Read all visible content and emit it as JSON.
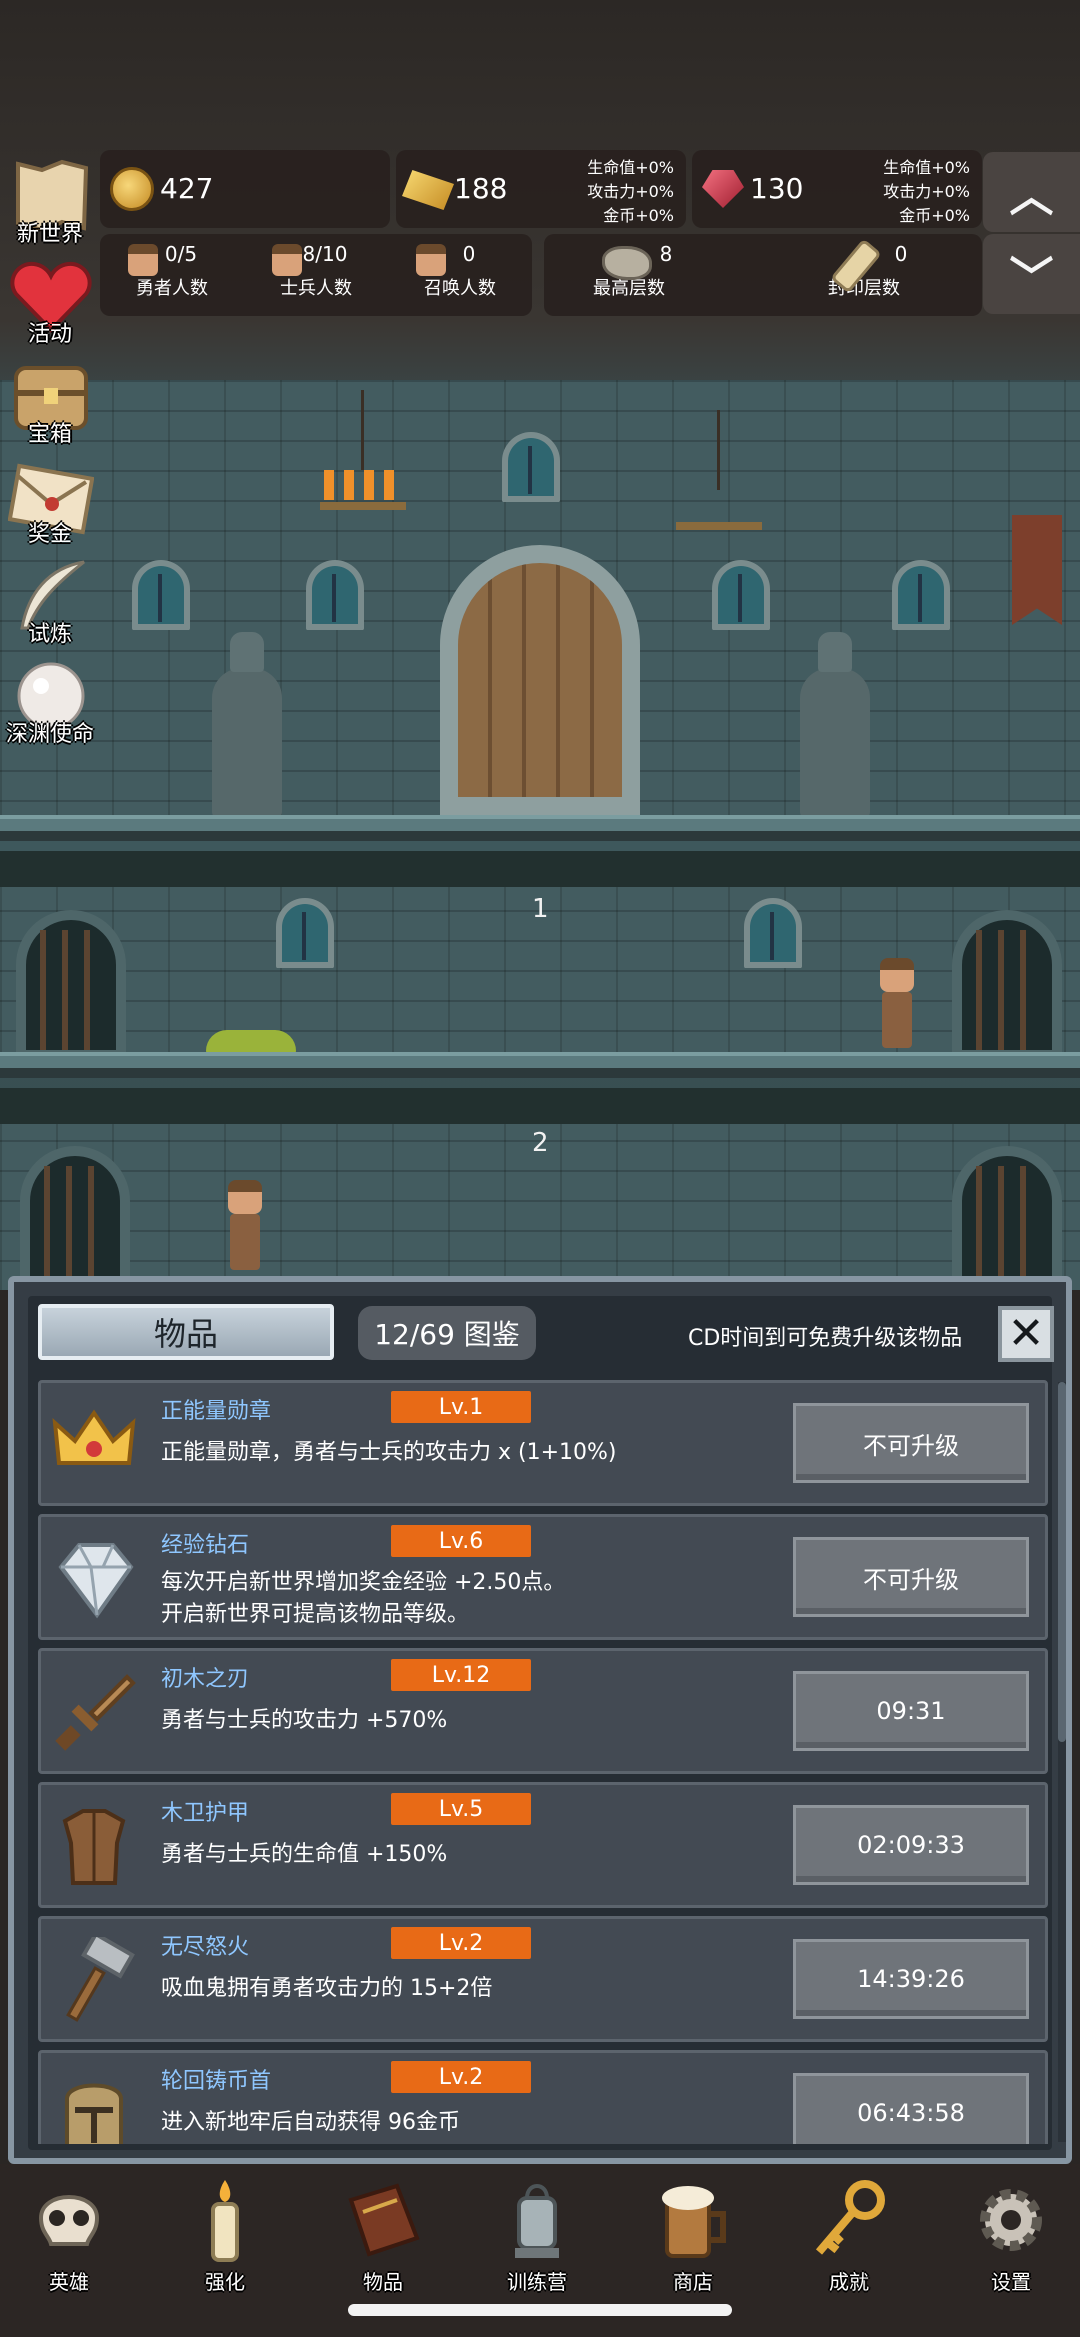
{
  "resources": {
    "gold": {
      "icon": "gold-coin-icon",
      "value": "427"
    },
    "gold_bar": {
      "icon": "gold-bar-icon",
      "value": "188",
      "bonuses": [
        "生命值+0%",
        "攻击力+0%",
        "金币+0%"
      ]
    },
    "ruby": {
      "icon": "ruby-icon",
      "value": "130",
      "bonuses": [
        "生命值+0%",
        "攻击力+0%",
        "金币+0%"
      ]
    }
  },
  "counts": [
    {
      "icon": "hero-face-icon",
      "value": "0/5",
      "label": "勇者人数"
    },
    {
      "icon": "soldier-face-icon",
      "value": "8/10",
      "label": "士兵人数"
    },
    {
      "icon": "summon-face-icon",
      "value": "0",
      "label": "召唤人数"
    },
    {
      "icon": "stone-icon",
      "value": "8",
      "label": "最高层数"
    },
    {
      "icon": "scroll-icon",
      "value": "0",
      "label": "封印层数"
    }
  ],
  "side_menu": [
    {
      "icon": "map-icon",
      "label": "新世界"
    },
    {
      "icon": "heart-icon",
      "label": "活动"
    },
    {
      "icon": "treasure-chest-icon",
      "label": "宝箱"
    },
    {
      "icon": "envelope-icon",
      "label": "奖金"
    },
    {
      "icon": "feather-icon",
      "label": "试炼"
    },
    {
      "icon": "pearl-icon",
      "label": "深渊使命"
    }
  ],
  "scene": {
    "floor_numbers": [
      "1",
      "2"
    ]
  },
  "panel": {
    "title": "物品",
    "codex": "12/69 图鉴",
    "cd_text": "CD时间到可免费升级该物品",
    "close_icon": "close-icon",
    "items": [
      {
        "icon": "crown-icon",
        "name": "正能量勋章",
        "level": "Lv.1",
        "desc": [
          "正能量勋章，勇者与士兵的攻击力 x (1+10%)"
        ],
        "button": "不可升级"
      },
      {
        "icon": "diamond-icon",
        "name": "经验钻石",
        "level": "Lv.6",
        "desc": [
          "每次开启新世界增加奖金经验 +2.50点。",
          "开启新世界可提高该物品等级。"
        ],
        "button": "不可升级"
      },
      {
        "icon": "wooden-sword-icon",
        "name": "初木之刃",
        "level": "Lv.12",
        "desc": [
          "勇者与士兵的攻击力 +570%"
        ],
        "button": "09:31"
      },
      {
        "icon": "wooden-armor-icon",
        "name": "木卫护甲",
        "level": "Lv.5",
        "desc": [
          "勇者与士兵的生命值 +150%"
        ],
        "button": "02:09:33"
      },
      {
        "icon": "hammer-icon",
        "name": "无尽怒火",
        "level": "Lv.2",
        "desc": [
          "吸血鬼拥有勇者攻击力的 15+2倍"
        ],
        "button": "14:39:26"
      },
      {
        "icon": "helmet-icon",
        "name": "轮回铸币首",
        "level": "Lv.2",
        "desc": [
          "进入新地牢后自动获得 96金币"
        ],
        "button": "06:43:58"
      }
    ]
  },
  "bottom_nav": [
    {
      "icon": "skull-icon",
      "label": "英雄"
    },
    {
      "icon": "candle-icon",
      "label": "强化"
    },
    {
      "icon": "book-icon",
      "label": "物品"
    },
    {
      "icon": "lantern-icon",
      "label": "训练营"
    },
    {
      "icon": "beer-mug-icon",
      "label": "商店"
    },
    {
      "icon": "key-icon",
      "label": "成就"
    },
    {
      "icon": "gear-icon",
      "label": "设置"
    }
  ],
  "colors": {
    "level_badge": "#e86a16",
    "item_name": "#8fc7ff",
    "panel_bg": "#262d34"
  }
}
